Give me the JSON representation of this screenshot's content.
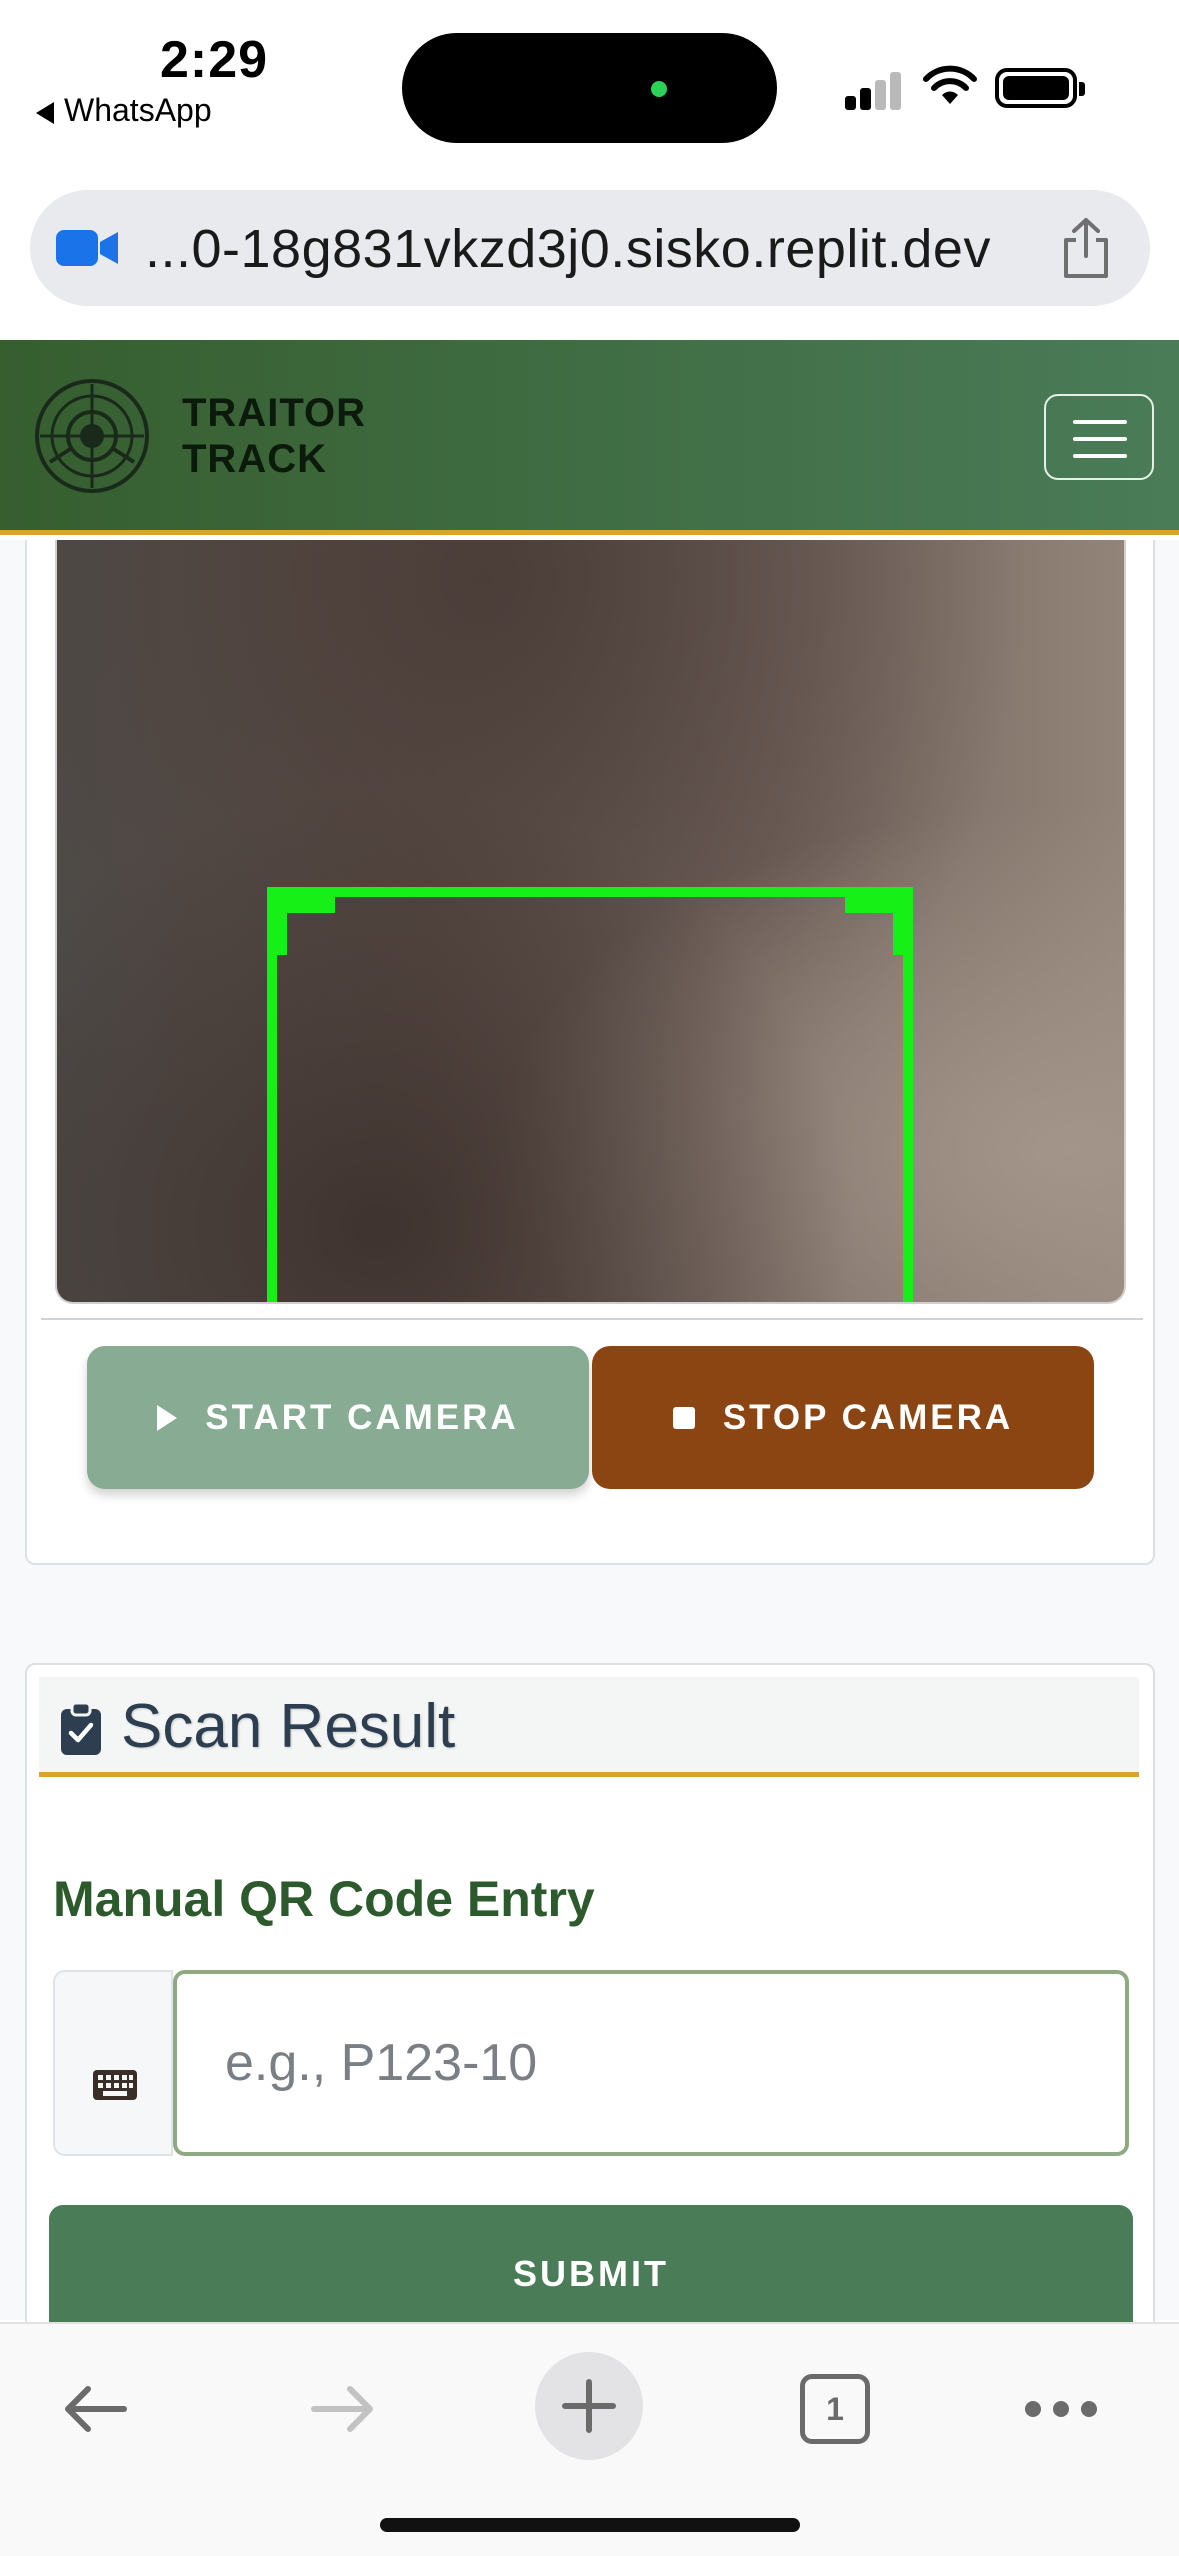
{
  "status_bar": {
    "time": "2:29",
    "back_app": "WhatsApp",
    "island_dot_color": "#2ed158"
  },
  "browser": {
    "url": "...0-18g831vkzd3j0.sisko.replit.dev",
    "tab_count": "1",
    "icons": [
      "video-camera-icon",
      "share-icon",
      "back-arrow-icon",
      "forward-arrow-icon",
      "plus-icon",
      "tabs-icon",
      "more-icon"
    ]
  },
  "header": {
    "brand_line1": "TRAITOR",
    "brand_line2": "TRACK",
    "logo_icon": "radar-crosshair-logo",
    "menu_icon": "hamburger-menu-icon",
    "gradient_start": "#365e2f",
    "gradient_end": "#4a7c58",
    "accent": "#d4a72c"
  },
  "camera": {
    "scan_frame_color": "#16f016",
    "start_label": "START CAMERA",
    "stop_label": "STOP CAMERA",
    "start_color": "#87ab93",
    "stop_color": "#8b4513"
  },
  "scan_result": {
    "title": "Scan Result",
    "title_icon": "clipboard-check-icon",
    "manual_label": "Manual QR Code Entry",
    "input_icon": "keyboard-icon",
    "input_value": "",
    "input_placeholder": "e.g., P123-10",
    "submit_label": "SUBMIT",
    "submit_color": "#4a7c58"
  }
}
